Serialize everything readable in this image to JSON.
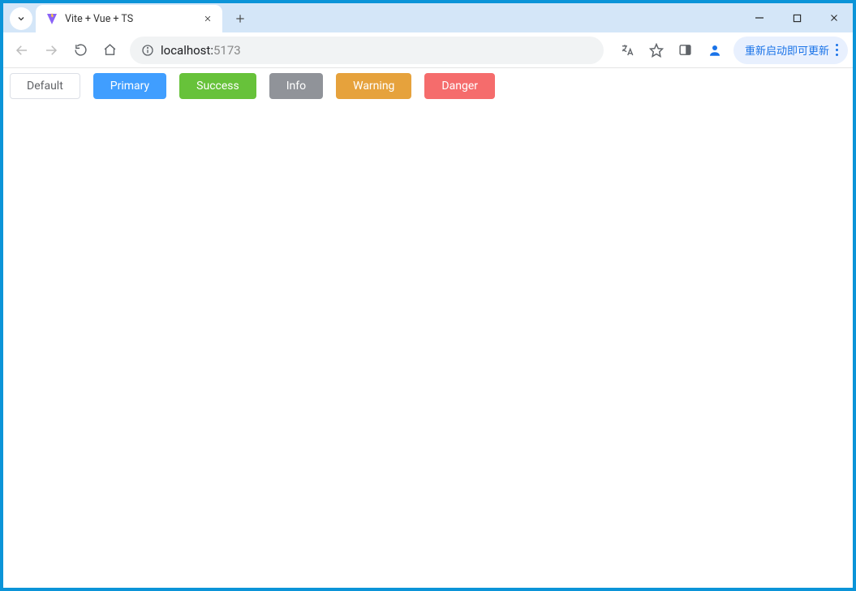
{
  "tab": {
    "title": "Vite + Vue + TS"
  },
  "address": {
    "host": "localhost:",
    "port": "5173"
  },
  "update_button": {
    "label": "重新启动即可更新"
  },
  "buttons": {
    "default": "Default",
    "primary": "Primary",
    "success": "Success",
    "info": "Info",
    "warning": "Warning",
    "danger": "Danger"
  },
  "colors": {
    "primary": "#409eff",
    "success": "#67c23a",
    "info": "#909399",
    "warning": "#e6a23c",
    "danger": "#f56c6c",
    "browser_blue": "#d4e6f8",
    "addr_bg": "#f1f3f4",
    "update_bg": "#e8f0fe",
    "update_fg": "#1a73e8"
  }
}
